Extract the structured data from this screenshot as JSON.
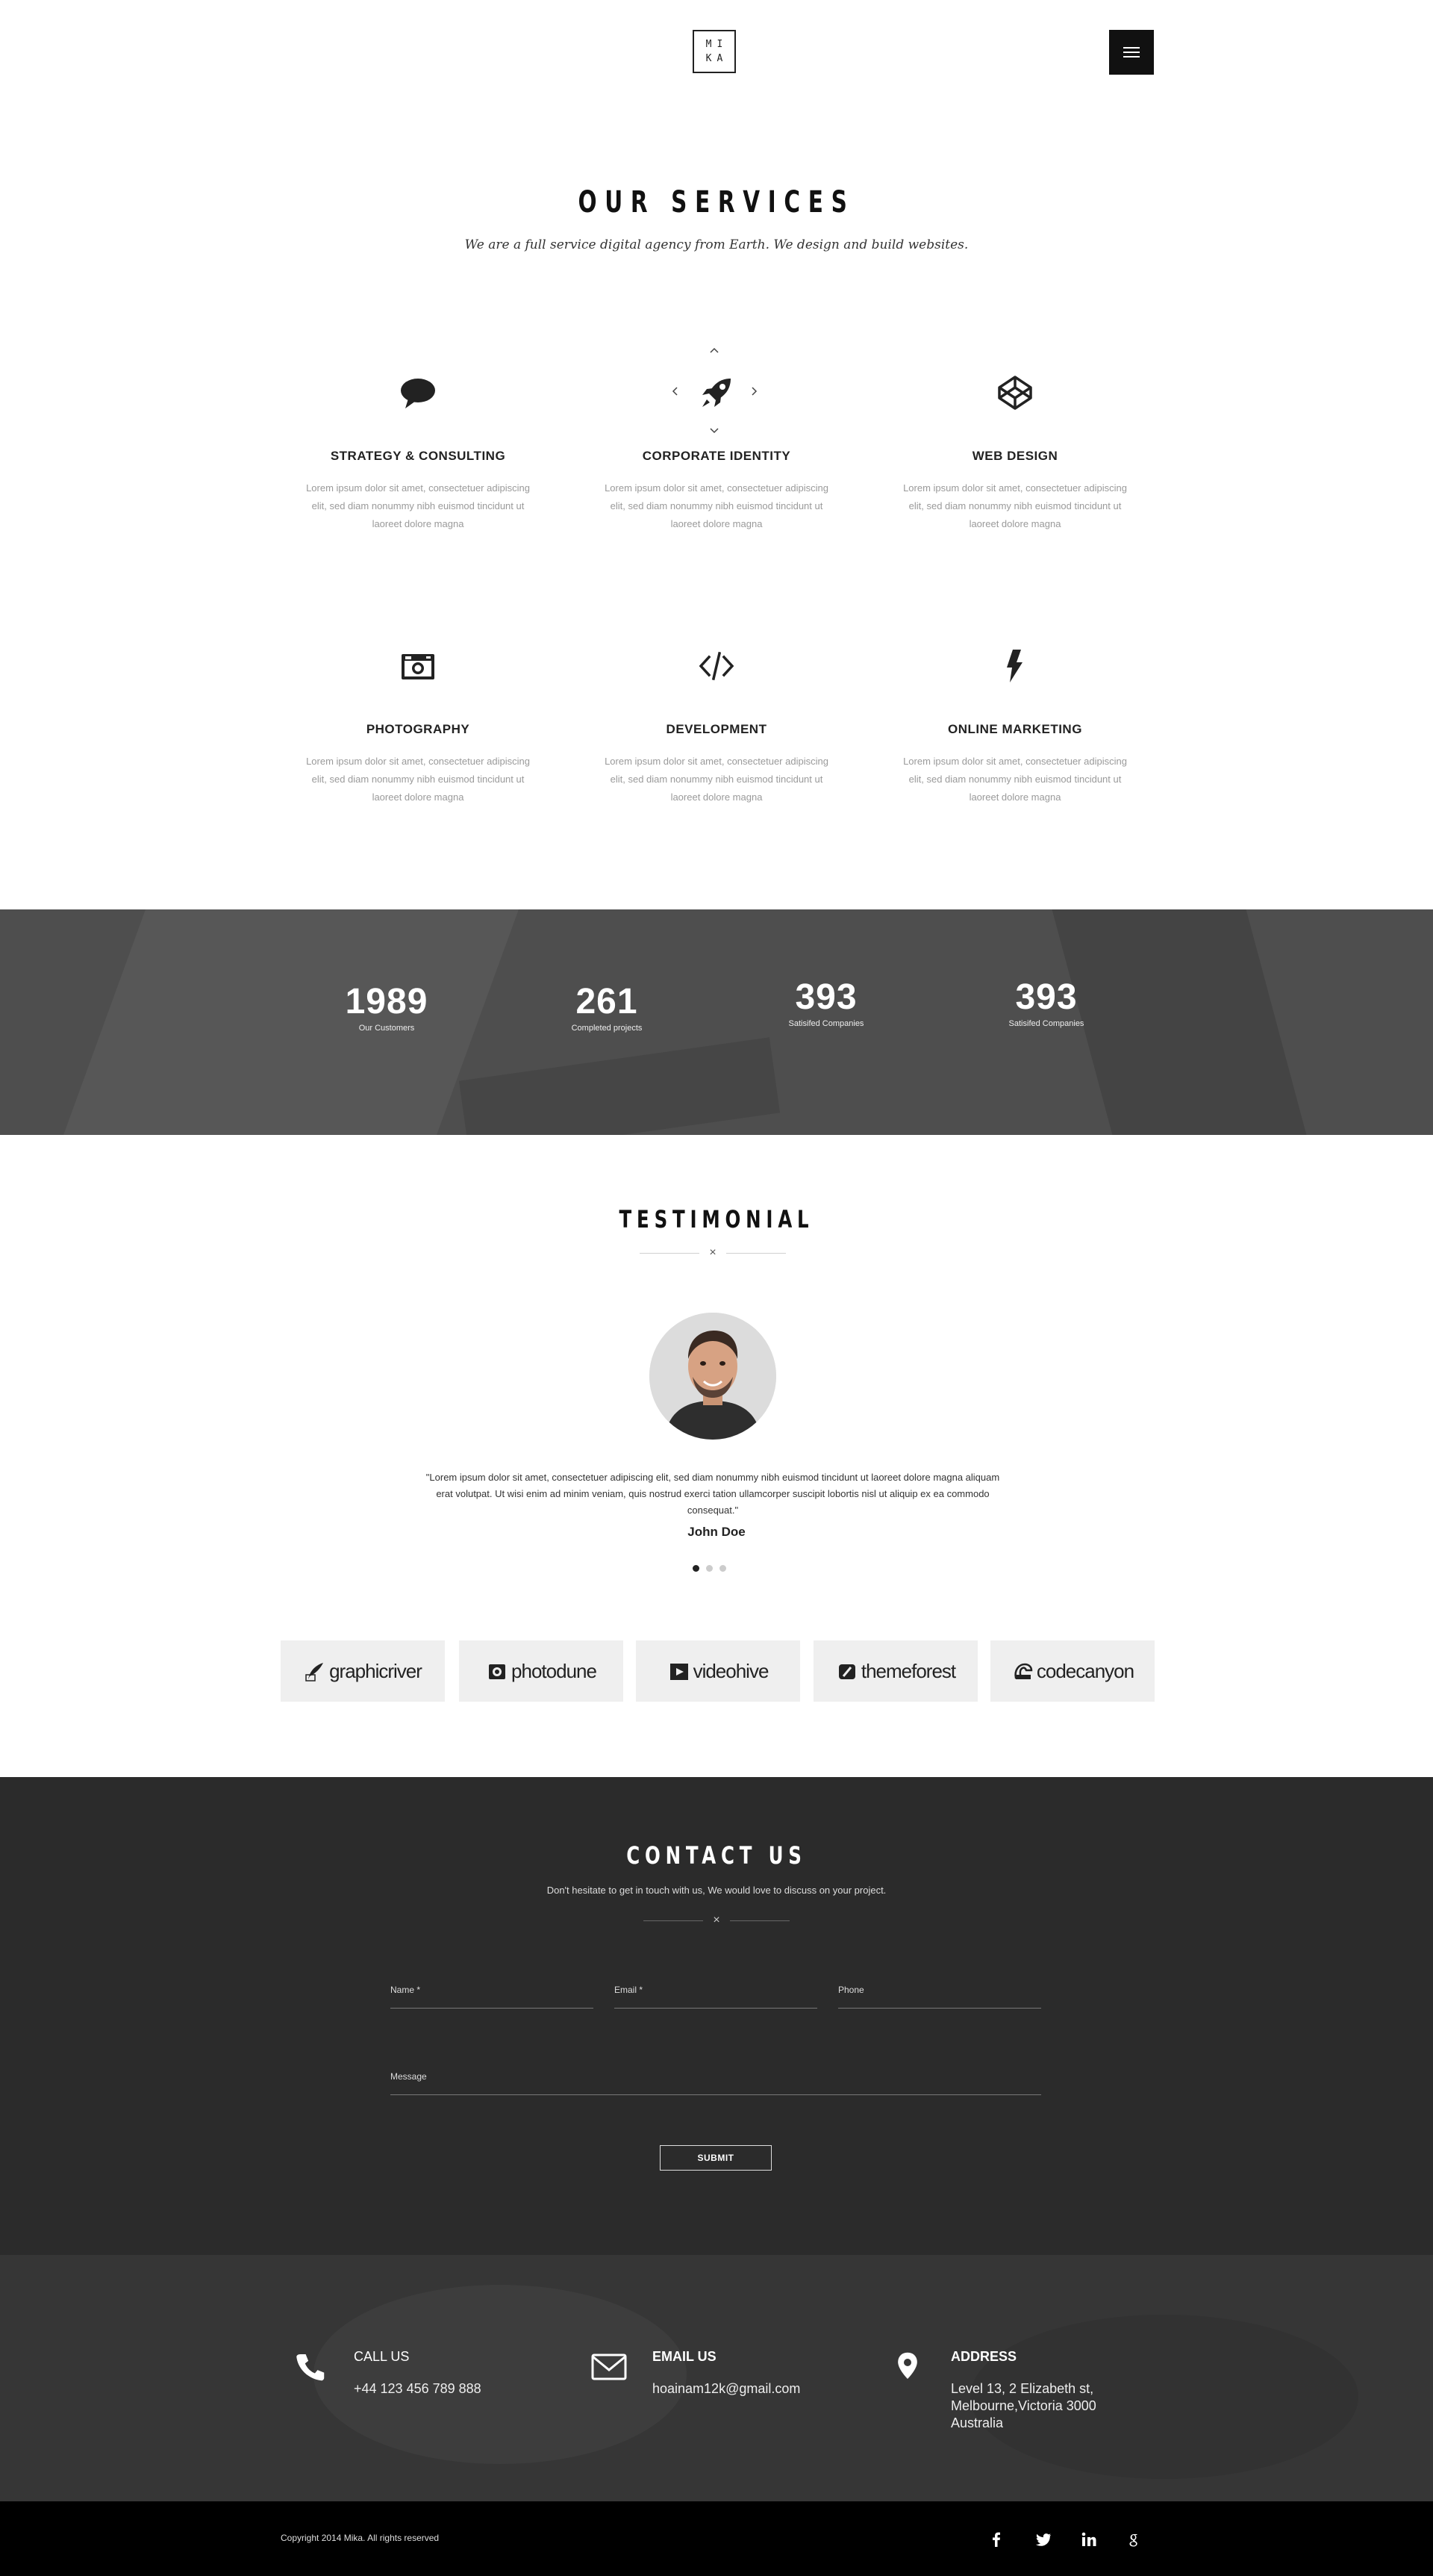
{
  "header": {
    "logo_line1": "MI",
    "logo_line2": "KA"
  },
  "services": {
    "title": "OUR SERVICES",
    "subtitle": "We are a full service digital agency from Earth. We design and build websites.",
    "items": [
      {
        "icon": "speech-bubble-icon",
        "title": "STRATEGY & CONSULTING",
        "text": "Lorem ipsum dolor sit amet, consectetuer adipiscing elit, sed diam nonummy nibh euismod tincidunt ut laoreet dolore magna"
      },
      {
        "icon": "rocket-icon",
        "title": "CORPORATE IDENTITY",
        "text": "Lorem ipsum dolor sit amet, consectetuer adipiscing elit, sed diam nonummy nibh euismod tincidunt ut laoreet dolore magna"
      },
      {
        "icon": "codepen-icon",
        "title": "WEB DESIGN",
        "text": "Lorem ipsum dolor sit amet, consectetuer adipiscing elit, sed diam nonummy nibh euismod tincidunt ut laoreet dolore magna"
      },
      {
        "icon": "camera-icon",
        "title": "PHOTOGRAPHY",
        "text": "Lorem ipsum dolor sit amet, consectetuer adipiscing elit, sed diam nonummy nibh euismod tincidunt ut laoreet dolore magna"
      },
      {
        "icon": "code-icon",
        "title": "DEVELOPMENT",
        "text": "Lorem ipsum dolor sit amet, consectetuer adipiscing elit, sed diam nonummy nibh euismod tincidunt ut laoreet dolore magna"
      },
      {
        "icon": "lightning-icon",
        "title": "ONLINE MARKETING",
        "text": "Lorem ipsum dolor sit amet, consectetuer adipiscing elit, sed diam nonummy nibh euismod tincidunt ut laoreet dolore magna"
      }
    ]
  },
  "stats": [
    {
      "value": "1989",
      "label": "Our Customers"
    },
    {
      "value": "261",
      "label": "Completed projects"
    },
    {
      "value": "393",
      "label": "Satisifed Companies"
    },
    {
      "value": "393",
      "label": "Satisifed Companies"
    }
  ],
  "testimonial": {
    "title": "TESTIMONIAL",
    "divider_symbol": "×",
    "quote": "\"Lorem ipsum dolor sit amet, consectetuer adipiscing elit, sed diam nonummy nibh euismod tincidunt ut laoreet dolore magna aliquam erat volutpat. Ut wisi enim ad minim veniam, quis nostrud exerci tation ullamcorper suscipit lobortis nisl ut aliquip ex ea commodo consequat.\"",
    "author": "John Doe",
    "slides": 3,
    "active_slide": 1
  },
  "clients": [
    {
      "name": "graphicriver",
      "icon": "graphicriver-icon"
    },
    {
      "name": "photodune",
      "icon": "photodune-icon"
    },
    {
      "name": "videohive",
      "icon": "videohive-icon"
    },
    {
      "name": "themeforest",
      "icon": "themeforest-icon"
    },
    {
      "name": "codecanyon",
      "icon": "codecanyon-icon"
    }
  ],
  "contact": {
    "title": "CONTACT US",
    "subtitle": "Don't hesitate to get in touch with us, We would love to discuss on your project.",
    "divider_symbol": "×",
    "name_label": "Name *",
    "email_label": "Email *",
    "phone_label": "Phone",
    "message_label": "Message",
    "submit_label": "SUBMIT"
  },
  "info": {
    "call_title": "CALL US",
    "call_value": "+44 123 456 789 888",
    "email_title": "EMAIL US",
    "email_value": "hoainam12k@gmail.com",
    "address_title": "ADDRESS",
    "address_line1": "Level 13, 2 Elizabeth st,",
    "address_line2": "Melbourne,Victoria 3000",
    "address_line3": "Australia"
  },
  "footer": {
    "copyright": "Copyright 2014 Mika. All rights reserved",
    "social": [
      "facebook-icon",
      "twitter-icon",
      "linkedin-icon",
      "google-plus-icon"
    ]
  },
  "colors": {
    "dark_section": "#2b2b2b",
    "footer": "#000000",
    "accent": "#111111"
  }
}
